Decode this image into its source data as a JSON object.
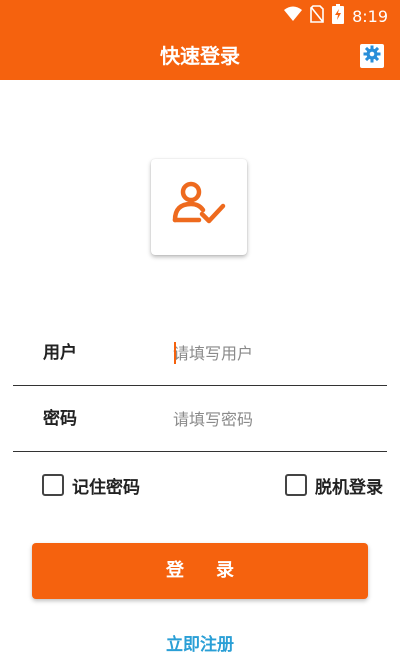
{
  "status_bar": {
    "time": "8:19",
    "icons": [
      "wifi-icon",
      "no-sim-icon",
      "battery-charging-icon"
    ]
  },
  "app_bar": {
    "title": "快速登录",
    "settings_icon": "gear-icon"
  },
  "logo": {
    "icon": "user-check-icon"
  },
  "form": {
    "username": {
      "label": "用户",
      "placeholder": "请填写用户",
      "value": ""
    },
    "password": {
      "label": "密码",
      "placeholder": "请填写密码",
      "value": ""
    }
  },
  "options": {
    "remember_label": "记住密码",
    "remember_checked": false,
    "offline_label": "脱机登录",
    "offline_checked": false
  },
  "actions": {
    "login_label": "登录",
    "register_label": "立即注册"
  },
  "colors": {
    "primary": "#f5620e",
    "link": "#2a9fd6"
  }
}
